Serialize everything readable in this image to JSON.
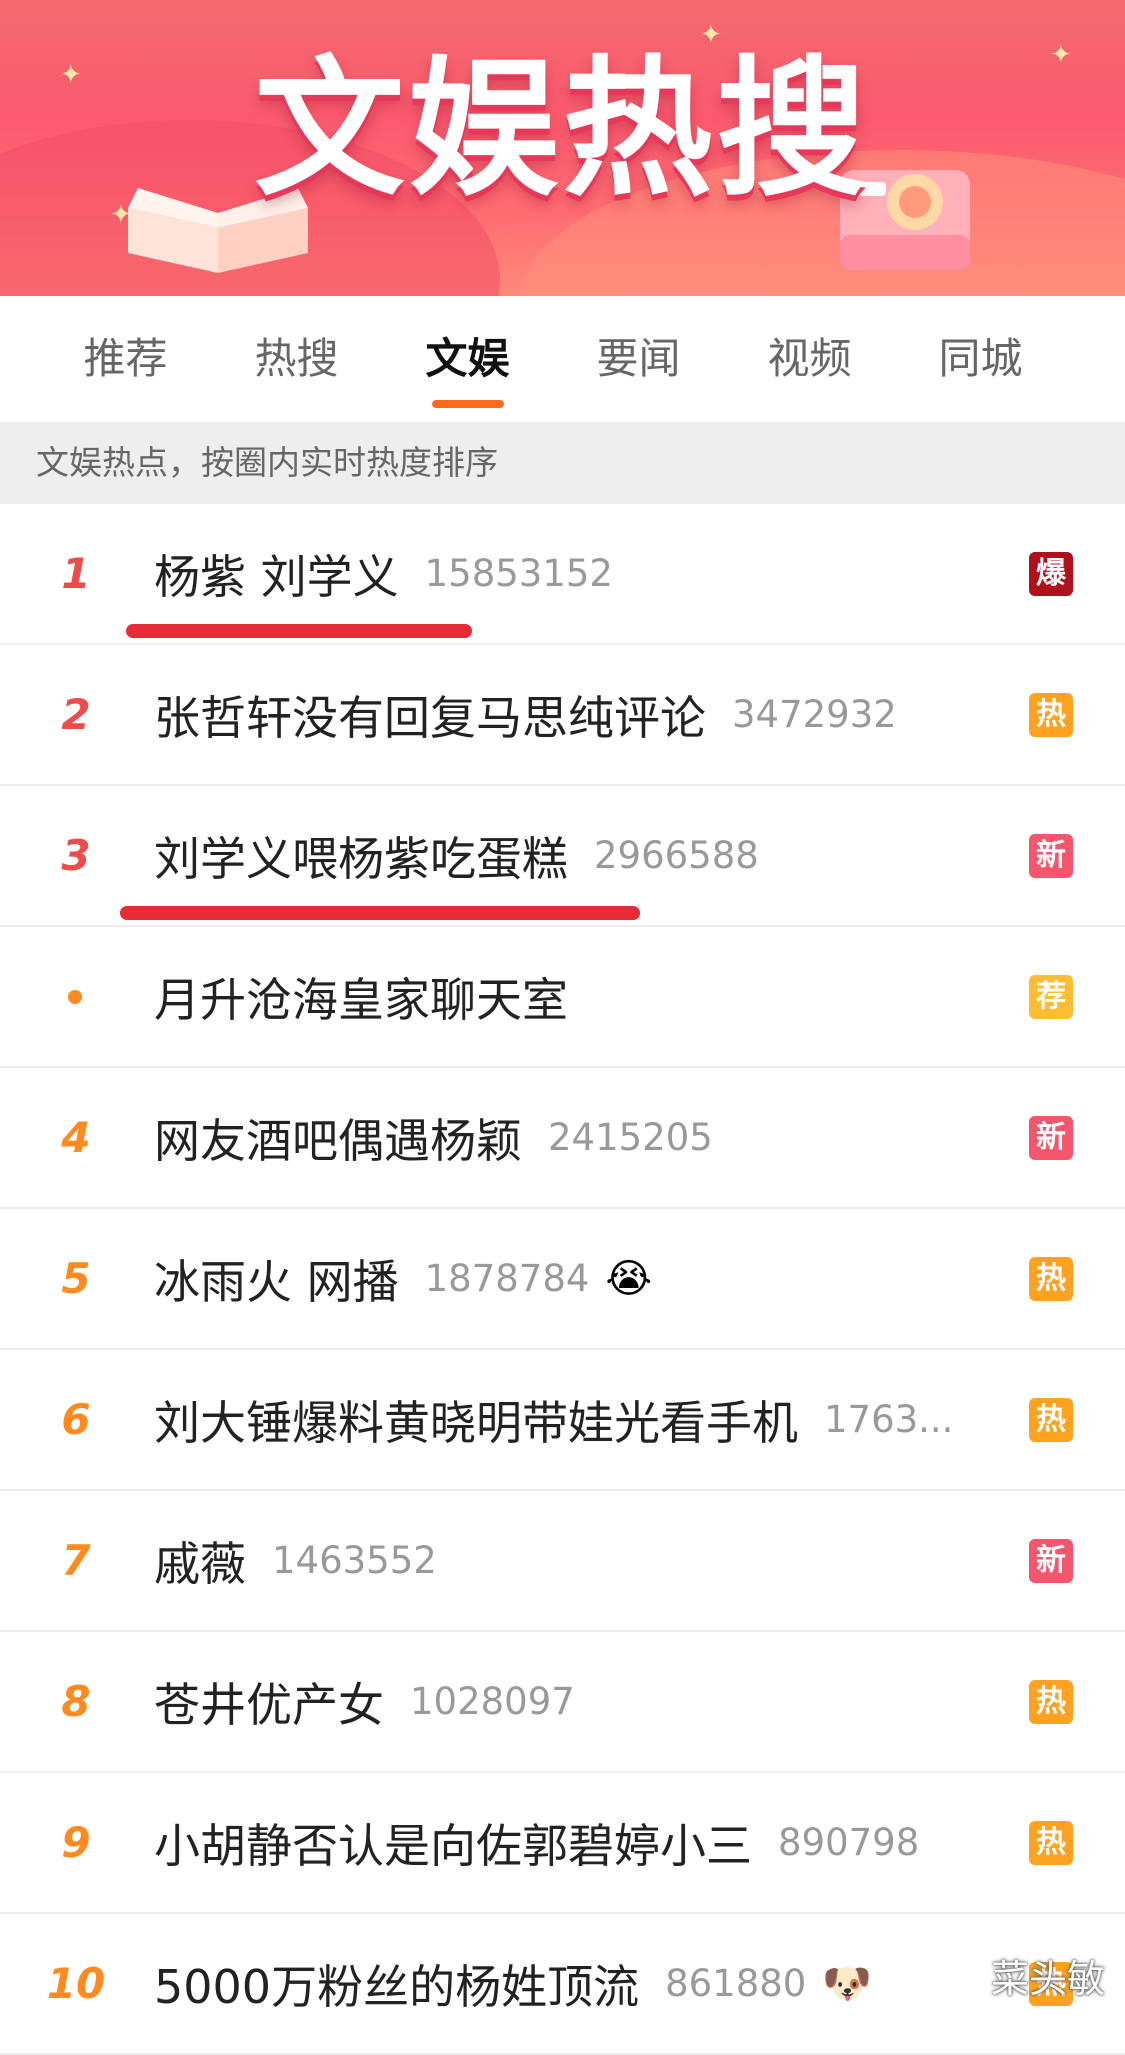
{
  "banner": {
    "title": "文娱热搜"
  },
  "tabs": [
    {
      "label": "推荐",
      "active": false
    },
    {
      "label": "热搜",
      "active": false
    },
    {
      "label": "文娱",
      "active": true
    },
    {
      "label": "要闻",
      "active": false
    },
    {
      "label": "视频",
      "active": false
    },
    {
      "label": "同城",
      "active": false
    }
  ],
  "subheader": "文娱热点，按圈内实时热度排序",
  "items": [
    {
      "rank": "1",
      "title": "杨紫 刘学义",
      "count": "15853152",
      "badge": "爆",
      "badge_color": "#b0101a",
      "rank_color": "top"
    },
    {
      "rank": "2",
      "title": "张哲轩没有回复马思纯评论",
      "count": "3472932",
      "badge": "热",
      "badge_color": "#ffa21f",
      "rank_color": "top"
    },
    {
      "rank": "3",
      "title": "刘学义喂杨紫吃蛋糕",
      "count": "2966588",
      "badge": "新",
      "badge_color": "#f5566e",
      "rank_color": "top"
    },
    {
      "rank": "",
      "title": "月升沧海皇家聊天室",
      "count": "",
      "badge": "荐",
      "badge_color": "#ffbd33",
      "rank_color": "dot"
    },
    {
      "rank": "4",
      "title": "网友酒吧偶遇杨颖",
      "count": "2415205",
      "badge": "新",
      "badge_color": "#f5566e",
      "rank_color": "normal"
    },
    {
      "rank": "5",
      "title": "冰雨火 网播",
      "count": "1878784",
      "emoji": "😭",
      "badge": "热",
      "badge_color": "#ffa21f",
      "rank_color": "normal"
    },
    {
      "rank": "6",
      "title": "刘大锤爆料黄晓明带娃光看手机",
      "count": "1763...",
      "badge": "热",
      "badge_color": "#ffa21f",
      "rank_color": "normal"
    },
    {
      "rank": "7",
      "title": "戚薇",
      "count": "1463552",
      "badge": "新",
      "badge_color": "#f5566e",
      "rank_color": "normal"
    },
    {
      "rank": "8",
      "title": "苍井优产女",
      "count": "1028097",
      "badge": "热",
      "badge_color": "#ffa21f",
      "rank_color": "normal"
    },
    {
      "rank": "9",
      "title": "小胡静否认是向佐郭碧婷小三",
      "count": "890798",
      "badge": "热",
      "badge_color": "#ffa21f",
      "rank_color": "normal"
    },
    {
      "rank": "10",
      "title": "5000万粉丝的杨姓顶流",
      "count": "861880",
      "emoji": "🐶",
      "badge": "热",
      "badge_color": "#ffa21f",
      "rank_color": "normal"
    }
  ],
  "watermark": "菜头敏",
  "colors": {
    "accent": "#ff6a1a",
    "underline": "#e62b36"
  }
}
